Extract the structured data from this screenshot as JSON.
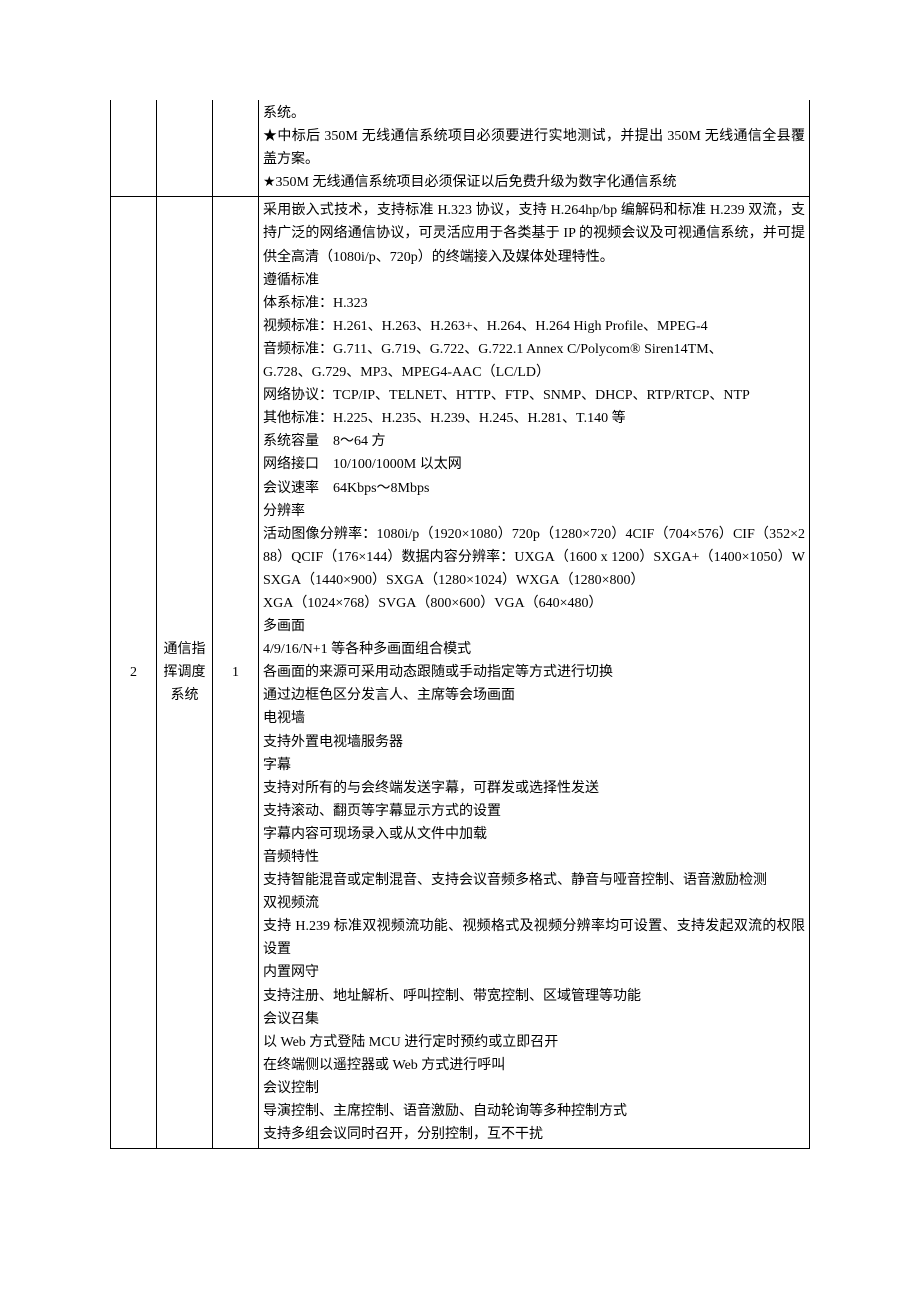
{
  "rows": [
    {
      "idx": "",
      "name": "",
      "qty": "",
      "lines": [
        "系统。",
        "★中标后 350M 无线通信系统项目必须要进行实地测试，并提出 350M 无线通信全县覆盖方案。",
        "★350M 无线通信系统项目必须保证以后免费升级为数字化通信系统"
      ]
    },
    {
      "idx": "2",
      "name": "通信指挥调度系统",
      "qty": "1",
      "lines": [
        "采用嵌入式技术，支持标准 H.323 协议，支持 H.264hp/bp 编解码和标准 H.239 双流，支持广泛的网络通信协议，可灵活应用于各类基于 IP 的视频会议及可视通信系统，并可提供全高清（1080i/p、720p）的终端接入及媒体处理特性。",
        "遵循标准",
        "体系标准：H.323",
        "视频标准：H.261、H.263、H.263+、H.264、H.264 High Profile、MPEG-4",
        "音频标准：G.711、G.719、G.722、G.722.1 Annex C/Polycom® Siren14TM、",
        "G.728、G.729、MP3、MPEG4-AAC（LC/LD）",
        "网络协议：TCP/IP、TELNET、HTTP、FTP、SNMP、DHCP、RTP/RTCP、NTP",
        "其他标准：H.225、H.235、H.239、H.245、H.281、T.140 等",
        "系统容量　8～64 方",
        "网络接口　10/100/1000M 以太网",
        "会议速率　64Kbps～8Mbps",
        "分辨率",
        "活动图像分辨率：1080i/p（1920×1080）720p（1280×720）4CIF（704×576）CIF（352×288）QCIF（176×144）数据内容分辨率：UXGA（1600 x 1200）SXGA+（1400×1050）WSXGA（1440×900）SXGA（1280×1024）WXGA（1280×800）",
        "XGA（1024×768）SVGA（800×600）VGA（640×480）",
        "多画面",
        "4/9/16/N+1 等各种多画面组合模式",
        "各画面的来源可采用动态跟随或手动指定等方式进行切换",
        "通过边框色区分发言人、主席等会场画面",
        "电视墙",
        "支持外置电视墙服务器",
        "字幕",
        "支持对所有的与会终端发送字幕，可群发或选择性发送",
        "支持滚动、翻页等字幕显示方式的设置",
        "字幕内容可现场录入或从文件中加载",
        "音频特性",
        "支持智能混音或定制混音、支持会议音频多格式、静音与哑音控制、语音激励检测",
        "双视频流",
        "支持 H.239 标准双视频流功能、视频格式及视频分辨率均可设置、支持发起双流的权限设置",
        "内置网守",
        "支持注册、地址解析、呼叫控制、带宽控制、区域管理等功能",
        "会议召集",
        "以 Web 方式登陆 MCU 进行定时预约或立即召开",
        "在终端侧以遥控器或 Web 方式进行呼叫",
        "会议控制",
        "导演控制、主席控制、语音激励、自动轮询等多种控制方式",
        "支持多组会议同时召开，分别控制，互不干扰"
      ]
    }
  ]
}
